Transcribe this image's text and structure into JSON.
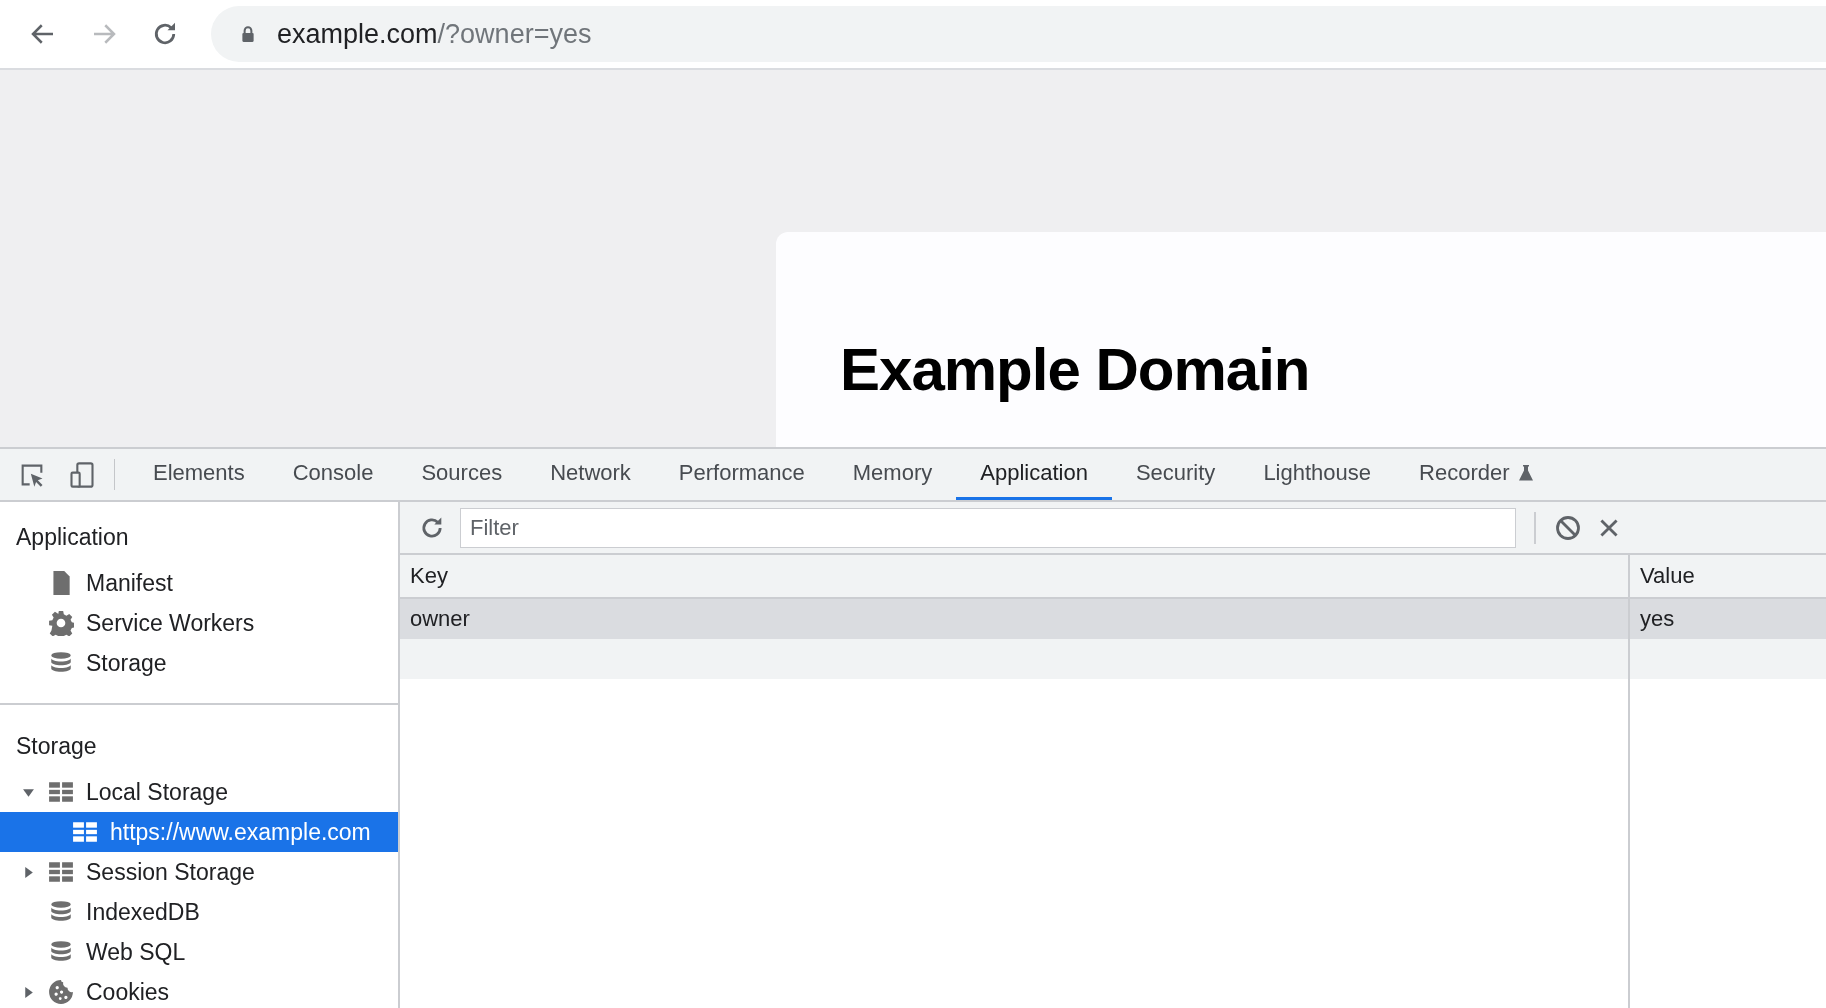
{
  "address_bar": {
    "host": "example.com",
    "path": "/?owner=yes"
  },
  "page": {
    "heading": "Example Domain"
  },
  "devtools_tabs": [
    {
      "label": "Elements",
      "selected": false
    },
    {
      "label": "Console",
      "selected": false
    },
    {
      "label": "Sources",
      "selected": false
    },
    {
      "label": "Network",
      "selected": false
    },
    {
      "label": "Performance",
      "selected": false
    },
    {
      "label": "Memory",
      "selected": false
    },
    {
      "label": "Application",
      "selected": true
    },
    {
      "label": "Security",
      "selected": false
    },
    {
      "label": "Lighthouse",
      "selected": false
    },
    {
      "label": "Recorder",
      "selected": false,
      "experimental": true
    }
  ],
  "sidebar": {
    "sections": [
      {
        "title": "Application",
        "items": [
          {
            "label": "Manifest",
            "kind": "manifest",
            "selected": false
          },
          {
            "label": "Service Workers",
            "kind": "workers",
            "selected": false
          },
          {
            "label": "Storage",
            "kind": "database",
            "selected": false
          }
        ]
      },
      {
        "title": "Storage",
        "items": [
          {
            "label": "Local Storage",
            "kind": "table",
            "selected": false,
            "expanded": true,
            "children": [
              {
                "label": "https://www.example.com",
                "kind": "table",
                "selected": true
              }
            ]
          },
          {
            "label": "Session Storage",
            "kind": "table",
            "selected": false,
            "expanded": false
          },
          {
            "label": "IndexedDB",
            "kind": "database",
            "selected": false
          },
          {
            "label": "Web SQL",
            "kind": "database",
            "selected": false
          },
          {
            "label": "Cookies",
            "kind": "cookies",
            "selected": false,
            "expanded": false
          }
        ]
      }
    ]
  },
  "toolbar": {
    "filter": {
      "placeholder": "Filter"
    }
  },
  "table": {
    "columns": [
      "Key",
      "Value"
    ],
    "rows": [
      {
        "cells": [
          "owner",
          "yes"
        ],
        "selected": true
      }
    ]
  }
}
